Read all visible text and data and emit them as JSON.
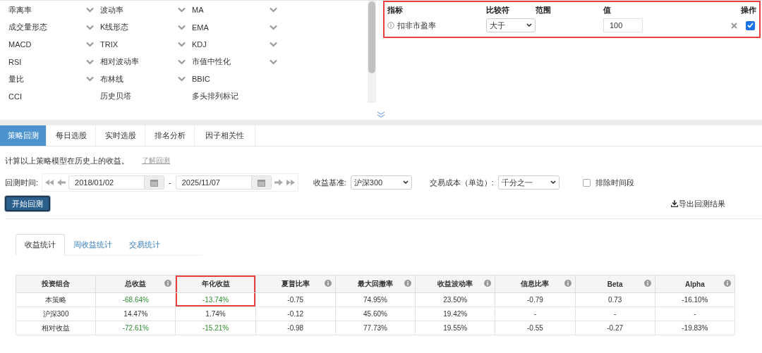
{
  "indicators": [
    {
      "label": "乖离率",
      "dropdown": true
    },
    {
      "label": "波动率",
      "dropdown": true
    },
    {
      "label": "MA",
      "dropdown": true
    },
    {
      "label": "成交量形态",
      "dropdown": true
    },
    {
      "label": "K线形态",
      "dropdown": true
    },
    {
      "label": "EMA",
      "dropdown": true
    },
    {
      "label": "MACD",
      "dropdown": true
    },
    {
      "label": "TRIX",
      "dropdown": true
    },
    {
      "label": "KDJ",
      "dropdown": true
    },
    {
      "label": "RSI",
      "dropdown": true
    },
    {
      "label": "相对波动率",
      "dropdown": true
    },
    {
      "label": "市值中性化",
      "dropdown": true
    },
    {
      "label": "量比",
      "dropdown": true
    },
    {
      "label": "布林线",
      "dropdown": true
    },
    {
      "label": "BBIC",
      "dropdown": false
    },
    {
      "label": "CCI",
      "dropdown": false
    },
    {
      "label": "历史贝塔",
      "dropdown": false
    },
    {
      "label": "多头排列标记",
      "dropdown": false
    }
  ],
  "filter_panel": {
    "highlighted": true,
    "columns": [
      "指标",
      "比较符",
      "范围",
      "值",
      "操作"
    ],
    "rows": [
      {
        "indicator": "扣非市盈率",
        "comparator": "大于",
        "value": "100",
        "checked": true
      }
    ]
  },
  "tabs": [
    {
      "label": "策略回测",
      "selected": true
    },
    {
      "label": "每日选股",
      "selected": false
    },
    {
      "label": "实时选股",
      "selected": false
    },
    {
      "label": "排名分析",
      "selected": false
    },
    {
      "label": "因子相关性",
      "selected": false
    }
  ],
  "description": "计算以上策略模型在历史上的收益。",
  "learn_link": "了解回测",
  "backtest": {
    "period_label": "回测时间:",
    "start_date": "2018/01/02",
    "separator": "-",
    "end_date": "2025/11/07",
    "benchmark_label": "收益基准:",
    "benchmark": "沪深300",
    "cost_label": "交易成本（单边）:",
    "cost": "千分之一",
    "exclude_label": "排除时间段",
    "exclude_checked": false,
    "start_button": "开始回测",
    "export_link": "导出回测结果"
  },
  "subtabs": [
    {
      "label": "收益统计",
      "selected": true
    },
    {
      "label": "周收益统计",
      "selected": false
    },
    {
      "label": "交易统计",
      "selected": false
    }
  ],
  "table": {
    "columns": [
      {
        "label": "投资组合",
        "info": false,
        "highlighted": false
      },
      {
        "label": "总收益",
        "info": true,
        "highlighted": false
      },
      {
        "label": "年化收益",
        "info": false,
        "highlighted": true
      },
      {
        "label": "夏普比率",
        "info": true,
        "highlighted": false
      },
      {
        "label": "最大回撤率",
        "info": true,
        "highlighted": false
      },
      {
        "label": "收益波动率",
        "info": true,
        "highlighted": false
      },
      {
        "label": "信息比率",
        "info": true,
        "highlighted": false
      },
      {
        "label": "Beta",
        "info": true,
        "highlighted": false
      },
      {
        "label": "Alpha",
        "info": true,
        "highlighted": false
      }
    ],
    "rows": [
      {
        "cells": [
          {
            "text": "本策略",
            "loss": false
          },
          {
            "text": "-68.64%",
            "loss": true
          },
          {
            "text": "-13.74%",
            "loss": true
          },
          {
            "text": "-0.75",
            "loss": false
          },
          {
            "text": "74.95%",
            "loss": false
          },
          {
            "text": "23.50%",
            "loss": false
          },
          {
            "text": "-0.79",
            "loss": false
          },
          {
            "text": "0.73",
            "loss": false
          },
          {
            "text": "-16.10%",
            "loss": false
          }
        ]
      },
      {
        "cells": [
          {
            "text": "沪深300",
            "loss": false
          },
          {
            "text": "14.47%",
            "loss": false
          },
          {
            "text": "1.74%",
            "loss": false
          },
          {
            "text": "-0.12",
            "loss": false
          },
          {
            "text": "45.60%",
            "loss": false
          },
          {
            "text": "19.42%",
            "loss": false
          },
          {
            "text": "-",
            "loss": false
          },
          {
            "text": "-",
            "loss": false
          },
          {
            "text": "-",
            "loss": false
          }
        ]
      },
      {
        "cells": [
          {
            "text": "相对收益",
            "loss": false
          },
          {
            "text": "-72.61%",
            "loss": true
          },
          {
            "text": "-15.21%",
            "loss": true
          },
          {
            "text": "-0.98",
            "loss": false
          },
          {
            "text": "77.73%",
            "loss": false
          },
          {
            "text": "19.55%",
            "loss": false
          },
          {
            "text": "-0.55",
            "loss": false
          },
          {
            "text": "-0.27",
            "loss": false
          },
          {
            "text": "-19.83%",
            "loss": false
          }
        ]
      }
    ]
  }
}
